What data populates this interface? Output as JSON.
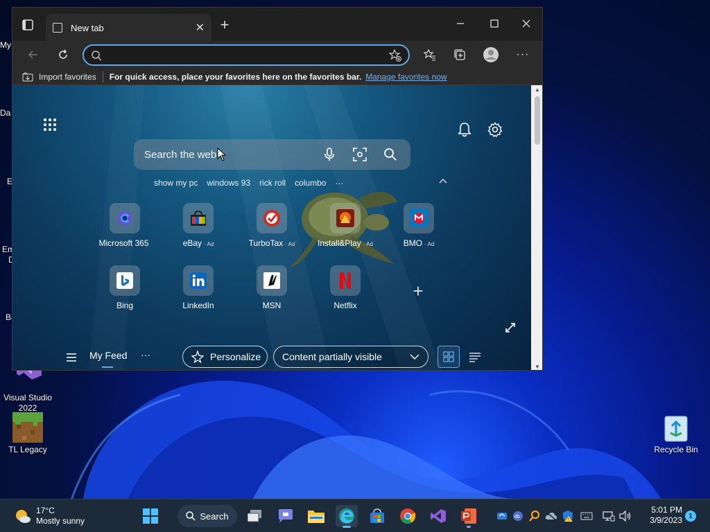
{
  "desktop": {
    "icons": [
      {
        "label": "Visual Studio 2022",
        "line1": "Visual Studio",
        "line2": "2022"
      },
      {
        "label": "TL Legacy"
      },
      {
        "label": "Recycle Bin"
      }
    ],
    "edge_fragments": [
      "My",
      "Da",
      "E",
      "Em",
      "D",
      "Ba"
    ]
  },
  "browser": {
    "tab_title": "New tab",
    "address_placeholder": "",
    "favorites_bar": {
      "import_label": "Import favorites",
      "hint": "For quick access, place your favorites here on the favorites bar.",
      "manage_link": "Manage favorites now"
    },
    "newtab": {
      "search_placeholder": "Search the web",
      "suggestions": [
        "show my pc",
        "windows 93",
        "rick roll",
        "columbo",
        "···"
      ],
      "tiles_row1": [
        {
          "label": "Microsoft 365",
          "ad": ""
        },
        {
          "label": "eBay",
          "ad": "· Ad"
        },
        {
          "label": "TurboTax",
          "ad": "· Ad"
        },
        {
          "label": "Install&Play",
          "ad": "· Ad"
        },
        {
          "label": "BMO",
          "ad": "· Ad"
        }
      ],
      "tiles_row2": [
        {
          "label": "Bing"
        },
        {
          "label": "LinkedIn"
        },
        {
          "label": "MSN"
        },
        {
          "label": "Netflix"
        }
      ],
      "feed": {
        "my_feed": "My Feed",
        "more": "···",
        "personalize": "Personalize",
        "content_visibility": "Content partially visible"
      }
    }
  },
  "taskbar": {
    "weather_temp": "17°C",
    "weather_desc": "Mostly sunny",
    "search_label": "Search",
    "time": "5:01 PM",
    "date": "3/9/2023",
    "notification_count": "1"
  },
  "colors": {
    "accent": "#62a8e6",
    "link": "#74b1ec",
    "taskbar": "#1d2a3a"
  }
}
